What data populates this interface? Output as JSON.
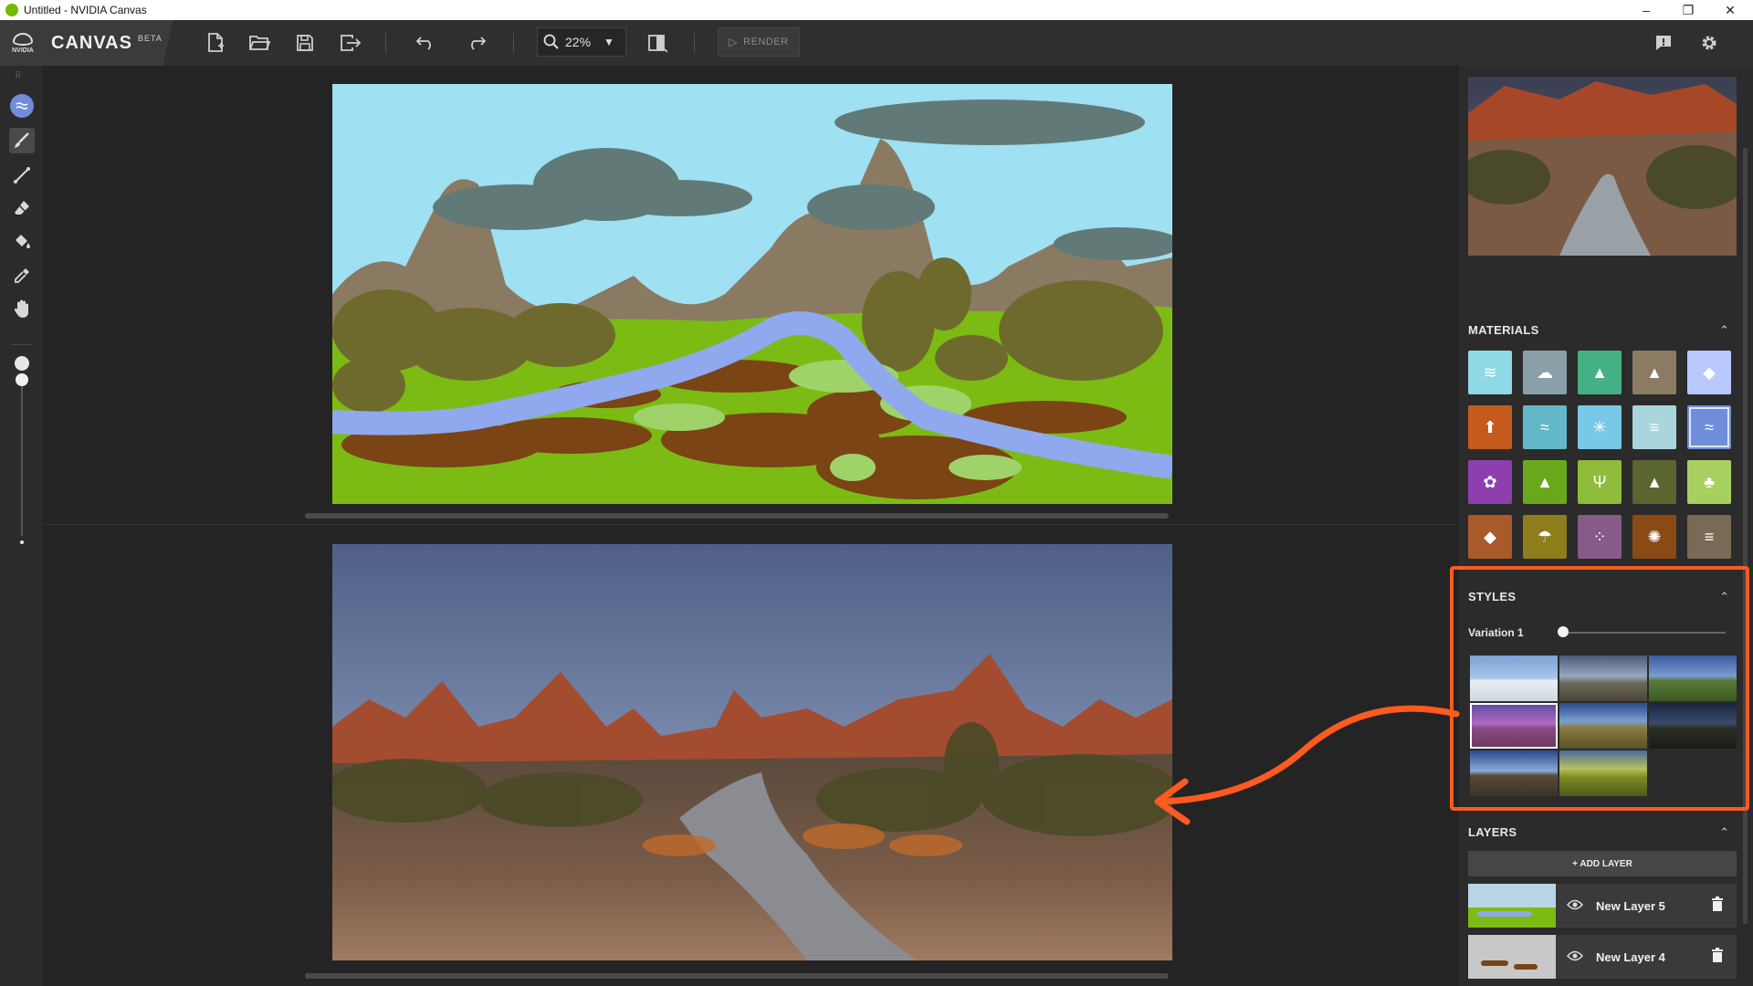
{
  "window": {
    "title": "Untitled - NVIDIA Canvas",
    "minimize": "–",
    "maximize": "❐",
    "close": "✕"
  },
  "brand": {
    "logo_text": "NVIDIA",
    "name": "CANVAS",
    "badge": "BETA"
  },
  "toolbar": {
    "icons": [
      "new-file-icon",
      "open-folder-icon",
      "save-icon",
      "export-icon",
      "undo-icon",
      "redo-icon",
      "zoom-icon",
      "compare-icon",
      "feedback-icon",
      "gear-icon"
    ],
    "zoom_value": "22%",
    "zoom_dropdown": "▼",
    "render_label": "RENDER",
    "render_icon": "▷"
  },
  "tools": [
    "material-brush-icon",
    "brush-icon",
    "line-icon",
    "eraser-icon",
    "fill-icon",
    "eyedropper-icon",
    "hand-icon"
  ],
  "materials": {
    "title": "MATERIALS",
    "collapse_icon": "⌃",
    "rows": [
      [
        {
          "icon": "≋",
          "color": "#8fd8e6",
          "name": "sea"
        },
        {
          "icon": "☁",
          "color": "#8aa0a8",
          "name": "cloud"
        },
        {
          "icon": "▲",
          "color": "#45b083",
          "name": "hill"
        },
        {
          "icon": "▲",
          "color": "#8c7b63",
          "name": "mountain"
        },
        {
          "icon": "◆",
          "color": "#b9c8ff",
          "name": "sky"
        }
      ],
      [
        {
          "icon": "⬆",
          "color": "#c45a1b",
          "name": "volcano"
        },
        {
          "icon": "≈",
          "color": "#62b8c8",
          "name": "fog"
        },
        {
          "icon": "✳",
          "color": "#78c8e8",
          "name": "snow"
        },
        {
          "icon": "≡",
          "color": "#a8d6dc",
          "name": "waterfall"
        },
        {
          "icon": "≈",
          "color": "#6f8dd8",
          "name": "river"
        }
      ],
      [
        {
          "icon": "✿",
          "color": "#8e3fae",
          "name": "flower"
        },
        {
          "icon": "▲",
          "color": "#6aa91c",
          "name": "grass"
        },
        {
          "icon": "Ψ",
          "color": "#8dbd3a",
          "name": "plant"
        },
        {
          "icon": "▲",
          "color": "#5a6530",
          "name": "bush"
        },
        {
          "icon": "♣",
          "color": "#a8d060",
          "name": "tree"
        }
      ],
      [
        {
          "icon": "◆",
          "color": "#a85a2a",
          "name": "rock"
        },
        {
          "icon": "☂",
          "color": "#8e7d1a",
          "name": "palm"
        },
        {
          "icon": "⁘",
          "color": "#875a8a",
          "name": "sand"
        },
        {
          "icon": "✺",
          "color": "#8a4a14",
          "name": "dirt"
        },
        {
          "icon": "≡",
          "color": "#786a54",
          "name": "stone"
        }
      ]
    ]
  },
  "styles": {
    "title": "STYLES",
    "collapse_icon": "⌃",
    "variation_label": "Variation 1",
    "variation_value": 0,
    "selected_index": 3
  },
  "layers": {
    "title": "LAYERS",
    "collapse_icon": "⌃",
    "add_label": "+ ADD LAYER",
    "items": [
      {
        "name": "New Layer 5"
      },
      {
        "name": "New Layer 4"
      }
    ]
  },
  "colors": {
    "accent": "#76b900",
    "annotation": "#ff5a1f",
    "panel": "#2b2b2b"
  }
}
